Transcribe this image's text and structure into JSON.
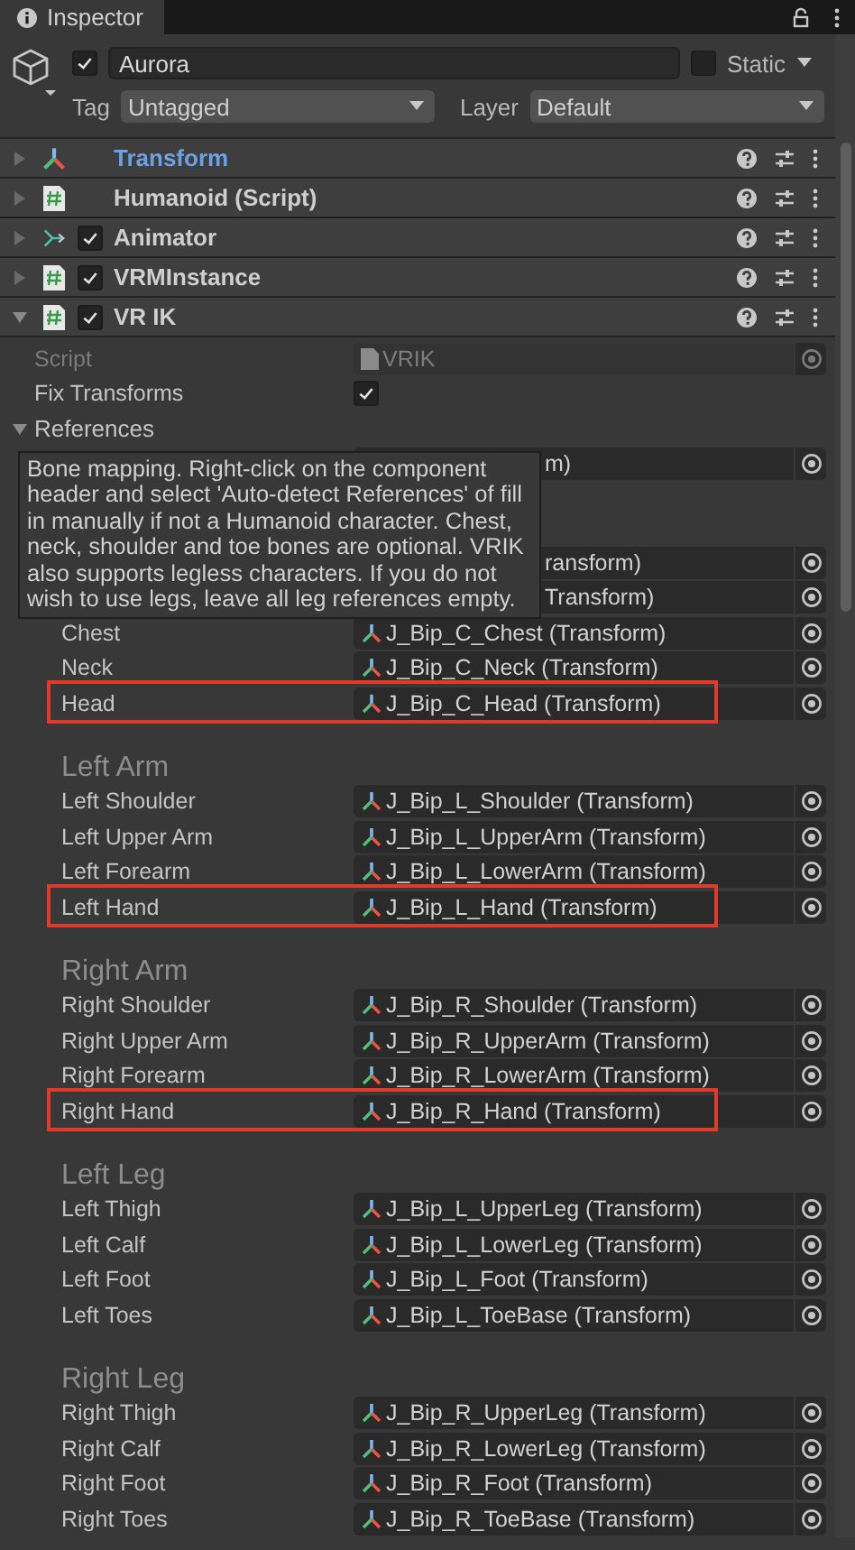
{
  "tab": {
    "label": "Inspector"
  },
  "object": {
    "active": true,
    "name": "Aurora",
    "static_label": "Static",
    "static": false,
    "tag_label": "Tag",
    "tag": "Untagged",
    "layer_label": "Layer",
    "layer": "Default"
  },
  "components": [
    {
      "kind": "transform",
      "name": "Transform",
      "expanded": false,
      "modified": true
    },
    {
      "kind": "script",
      "name": "Humanoid (Script)",
      "expanded": false,
      "modified": false
    },
    {
      "kind": "animator",
      "name": "Animator",
      "enabled": true,
      "expanded": false,
      "modified": false
    },
    {
      "kind": "script",
      "name": "VRMInstance",
      "enabled": true,
      "expanded": false,
      "modified": false
    },
    {
      "kind": "script",
      "name": "VR IK",
      "enabled": true,
      "expanded": true,
      "modified": false
    }
  ],
  "vrik": {
    "script": {
      "label": "Script",
      "value": "VRIK"
    },
    "fix_transforms": {
      "label": "Fix Transforms",
      "checked": true
    },
    "references": {
      "label": "References",
      "expanded": true
    },
    "tooltip": "Bone mapping. Right-click on the component header and select 'Auto-detect References' of fill in manually if not a Humanoid character. Chest, neck, shoulder and toe bones are optional. VRIK also supports legless characters. If you do not wish to use legs, leave all leg references empty.",
    "groups": [
      {
        "rows": [
          {
            "value": "m)",
            "covered": true,
            "highlighted": false
          }
        ]
      },
      {
        "rows": [
          {
            "value": "ransform)",
            "covered": true,
            "highlighted": false
          },
          {
            "value": "Transform)",
            "covered": true,
            "highlighted": false
          },
          {
            "label": "Chest",
            "value": "J_Bip_C_Chest (Transform)",
            "covered": false,
            "highlighted": false
          },
          {
            "label": "Neck",
            "value": "J_Bip_C_Neck (Transform)",
            "covered": false,
            "highlighted": false
          },
          {
            "label": "Head",
            "value": "J_Bip_C_Head (Transform)",
            "covered": false,
            "highlighted": true
          }
        ]
      },
      {
        "heading": "Left Arm",
        "rows": [
          {
            "label": "Left Shoulder",
            "value": "J_Bip_L_Shoulder (Transform)",
            "covered": false,
            "highlighted": false
          },
          {
            "label": "Left Upper Arm",
            "value": "J_Bip_L_UpperArm (Transform)",
            "covered": false,
            "highlighted": false
          },
          {
            "label": "Left Forearm",
            "value": "J_Bip_L_LowerArm (Transform)",
            "covered": false,
            "highlighted": false
          },
          {
            "label": "Left Hand",
            "value": "J_Bip_L_Hand (Transform)",
            "covered": false,
            "highlighted": true
          }
        ]
      },
      {
        "heading": "Right Arm",
        "rows": [
          {
            "label": "Right Shoulder",
            "value": "J_Bip_R_Shoulder (Transform)",
            "covered": false,
            "highlighted": false
          },
          {
            "label": "Right Upper Arm",
            "value": "J_Bip_R_UpperArm (Transform)",
            "covered": false,
            "highlighted": false
          },
          {
            "label": "Right Forearm",
            "value": "J_Bip_R_LowerArm (Transform)",
            "covered": false,
            "highlighted": false
          },
          {
            "label": "Right Hand",
            "value": "J_Bip_R_Hand (Transform)",
            "covered": false,
            "highlighted": true
          }
        ]
      },
      {
        "heading": "Left Leg",
        "rows": [
          {
            "label": "Left Thigh",
            "value": "J_Bip_L_UpperLeg (Transform)",
            "covered": false,
            "highlighted": false
          },
          {
            "label": "Left Calf",
            "value": "J_Bip_L_LowerLeg (Transform)",
            "covered": false,
            "highlighted": false
          },
          {
            "label": "Left Foot",
            "value": "J_Bip_L_Foot (Transform)",
            "covered": false,
            "highlighted": false
          },
          {
            "label": "Left Toes",
            "value": "J_Bip_L_ToeBase (Transform)",
            "covered": false,
            "highlighted": false
          }
        ]
      },
      {
        "heading": "Right Leg",
        "rows": [
          {
            "label": "Right Thigh",
            "value": "J_Bip_R_UpperLeg (Transform)",
            "covered": false,
            "highlighted": false
          },
          {
            "label": "Right Calf",
            "value": "J_Bip_R_LowerLeg (Transform)",
            "covered": false,
            "highlighted": false
          },
          {
            "label": "Right Foot",
            "value": "J_Bip_R_Foot (Transform)",
            "covered": false,
            "highlighted": false
          },
          {
            "label": "Right Toes",
            "value": "J_Bip_R_ToeBase (Transform)",
            "covered": false,
            "highlighted": false
          }
        ]
      }
    ]
  }
}
